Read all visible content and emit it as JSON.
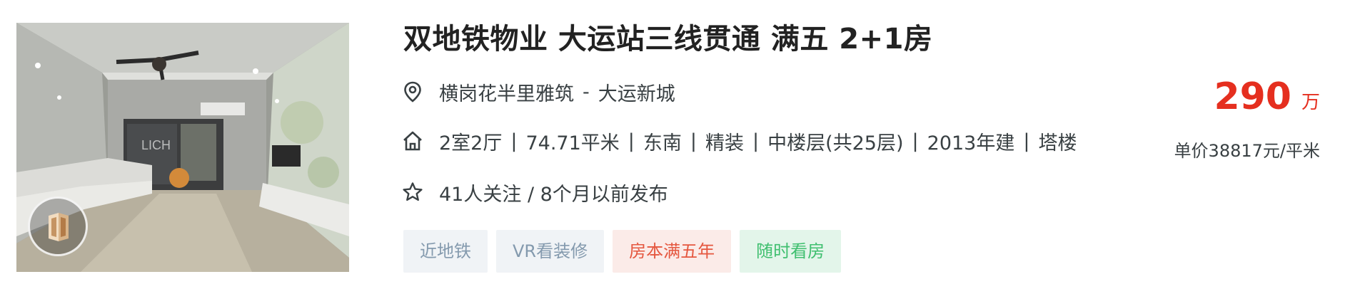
{
  "listing": {
    "title": "双地铁物业 大运站三线贯通 满五 2+1房",
    "community": "横岗花半里雅筑",
    "dash": "-",
    "district": "大运新城",
    "house_info": {
      "layout": "2室2厅",
      "area": "74.71平米",
      "orientation": "东南",
      "decoration": "精装",
      "floor": "中楼层(共25层)",
      "built": "2013年建",
      "building_type": "塔楼",
      "separator": "|"
    },
    "follow_info": "41人关注 / 8个月以前发布",
    "tags": [
      "近地铁",
      "VR看装修",
      "房本满五年",
      "随时看房"
    ],
    "price": {
      "total": "290",
      "unit": "万",
      "unit_price": "单价38817元/平米"
    },
    "photo_watermark": "LICH"
  },
  "icons": {
    "location": "location-pin-icon",
    "house": "house-icon",
    "follow": "star-icon",
    "vr": "vr-badge-icon"
  },
  "colors": {
    "price": "#e52f1f",
    "tag_gray_bg": "#f0f3f6",
    "tag_gray_text": "#849aae",
    "tag_red_bg": "#fbebe8",
    "tag_red_text": "#e5573f",
    "tag_green_bg": "#e3f5ea",
    "tag_green_text": "#3fbf6f"
  }
}
